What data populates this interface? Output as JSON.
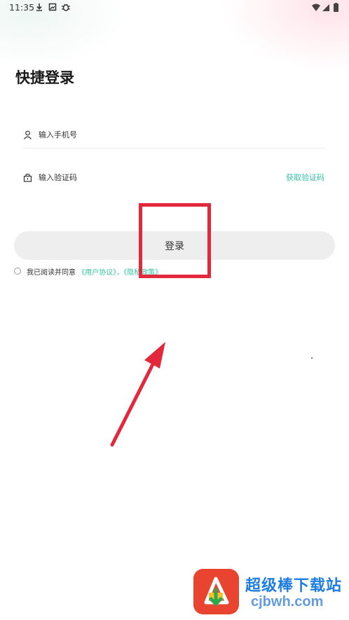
{
  "status_bar": {
    "time": "11:35",
    "icons": [
      "download-icon",
      "image-notification-icon",
      "bug-icon"
    ],
    "right_icons": [
      "wifi-icon",
      "signal-icon",
      "battery-icon"
    ]
  },
  "page": {
    "title": "快捷登录"
  },
  "form": {
    "phone_placeholder": "输入手机号",
    "code_placeholder": "输入验证码",
    "get_code_label": "获取验证码",
    "login_label": "登录"
  },
  "agreement": {
    "prefix": "我已阅读并同意",
    "user_agreement": "《用户协议》",
    "separator": "，",
    "privacy_policy": "《隐私政策》"
  },
  "colors": {
    "accent": "#34c2a5",
    "annotation": "#e4283c",
    "button_bg": "#eeeeee"
  },
  "watermark": {
    "site_name": "超级棒下载站",
    "url": "cjbwh.com"
  }
}
